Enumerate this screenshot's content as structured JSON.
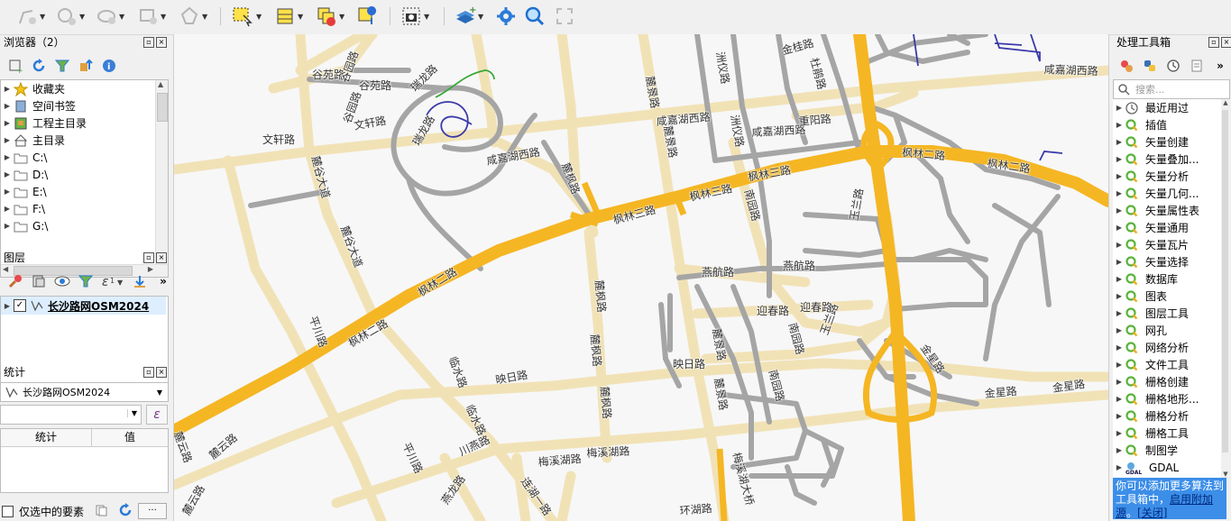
{
  "browser": {
    "title": "浏览器（2）",
    "items": [
      {
        "label": "收藏夹",
        "icon": "star-icon"
      },
      {
        "label": "空间书签",
        "icon": "bookmark-icon"
      },
      {
        "label": "工程主目录",
        "icon": "project-home-icon"
      },
      {
        "label": "主目录",
        "icon": "home-icon"
      },
      {
        "label": "C:\\",
        "icon": "folder-icon"
      },
      {
        "label": "D:\\",
        "icon": "folder-icon"
      },
      {
        "label": "E:\\",
        "icon": "folder-icon"
      },
      {
        "label": "F:\\",
        "icon": "folder-icon"
      },
      {
        "label": "G:\\",
        "icon": "folder-icon"
      }
    ]
  },
  "layers": {
    "title": "图层",
    "items": [
      {
        "label": "长沙路网OSM2024",
        "checked": true
      }
    ]
  },
  "stats": {
    "title": "统计",
    "layer_select": "长沙路网OSM2024",
    "expression_button": "ε",
    "col_stat": "统计",
    "col_value": "值",
    "selected_only_label": "仅选中的要素",
    "more_button": "···"
  },
  "processing": {
    "title": "处理工具箱",
    "search_placeholder": "搜索...",
    "items": [
      {
        "label": "最近用过",
        "icon": "clock-icon"
      },
      {
        "label": "插值",
        "icon": "qgis-icon"
      },
      {
        "label": "矢量创建",
        "icon": "qgis-icon"
      },
      {
        "label": "矢量叠加...",
        "icon": "qgis-icon"
      },
      {
        "label": "矢量分析",
        "icon": "qgis-icon"
      },
      {
        "label": "矢量几何...",
        "icon": "qgis-icon"
      },
      {
        "label": "矢量属性表",
        "icon": "qgis-icon"
      },
      {
        "label": "矢量通用",
        "icon": "qgis-icon"
      },
      {
        "label": "矢量瓦片",
        "icon": "qgis-icon"
      },
      {
        "label": "矢量选择",
        "icon": "qgis-icon"
      },
      {
        "label": "数据库",
        "icon": "qgis-icon"
      },
      {
        "label": "图表",
        "icon": "qgis-icon"
      },
      {
        "label": "图层工具",
        "icon": "qgis-icon"
      },
      {
        "label": "网孔",
        "icon": "qgis-icon"
      },
      {
        "label": "网络分析",
        "icon": "qgis-icon"
      },
      {
        "label": "文件工具",
        "icon": "qgis-icon"
      },
      {
        "label": "栅格创建",
        "icon": "qgis-icon"
      },
      {
        "label": "栅格地形...",
        "icon": "qgis-icon"
      },
      {
        "label": "栅格分析",
        "icon": "qgis-icon"
      },
      {
        "label": "栅格工具",
        "icon": "qgis-icon"
      },
      {
        "label": "制图学",
        "icon": "qgis-icon"
      },
      {
        "label": "GDAL",
        "icon": "gdal-icon"
      }
    ],
    "info_text": "你可以添加更多算法到工具箱中，",
    "info_link": "启用附加源",
    "info_tail": "。",
    "info_close": "[关闭]"
  },
  "map_labels": [
    {
      "text": "谷苑路"
    },
    {
      "text": "谷苑路"
    },
    {
      "text": "谷园路"
    },
    {
      "text": "谷园路"
    },
    {
      "text": "瑞龙路"
    },
    {
      "text": "瑞龙路"
    },
    {
      "text": "文轩路"
    },
    {
      "text": "文轩路"
    },
    {
      "text": "咸嘉湖西路"
    },
    {
      "text": "咸嘉湖西路"
    },
    {
      "text": "咸嘉湖西路"
    },
    {
      "text": "麓谷大道"
    },
    {
      "text": "麓谷大道"
    },
    {
      "text": "麓枫路"
    },
    {
      "text": "麓枫路"
    },
    {
      "text": "麓枫路"
    },
    {
      "text": "麓枫路"
    },
    {
      "text": "枫林二路"
    },
    {
      "text": "枫林三路"
    },
    {
      "text": "枫林三路"
    },
    {
      "text": "枫林三路"
    },
    {
      "text": "枫林二路"
    },
    {
      "text": "枫林二路"
    },
    {
      "text": "枫林二路"
    },
    {
      "text": "麓景路"
    },
    {
      "text": "麓景路"
    },
    {
      "text": "麓景路"
    },
    {
      "text": "麓景路"
    },
    {
      "text": "咸嘉湖西路"
    },
    {
      "text": "洲仪路"
    },
    {
      "text": "洲仪路"
    },
    {
      "text": "金桂路"
    },
    {
      "text": "杜鹃路"
    },
    {
      "text": "重阳路"
    },
    {
      "text": "南园路"
    },
    {
      "text": "南园路"
    },
    {
      "text": "南园路"
    },
    {
      "text": "燕航路"
    },
    {
      "text": "燕航路"
    },
    {
      "text": "迎春路"
    },
    {
      "text": "迎春路"
    },
    {
      "text": "玉兰路"
    },
    {
      "text": "玉兰路"
    },
    {
      "text": "金星路"
    },
    {
      "text": "金星路"
    },
    {
      "text": "金星路"
    },
    {
      "text": "平川路"
    },
    {
      "text": "平川路"
    },
    {
      "text": "临水路"
    },
    {
      "text": "临水路"
    },
    {
      "text": "映日路"
    },
    {
      "text": "映日路"
    },
    {
      "text": "川燕路"
    },
    {
      "text": "燕龙路"
    },
    {
      "text": "梅溪湖路"
    },
    {
      "text": "梅溪湖路"
    },
    {
      "text": "连湖一路"
    },
    {
      "text": "环湖路"
    },
    {
      "text": "梅溪湖大桥"
    },
    {
      "text": "麓云路"
    },
    {
      "text": "麓云路"
    },
    {
      "text": "麓云路"
    }
  ]
}
